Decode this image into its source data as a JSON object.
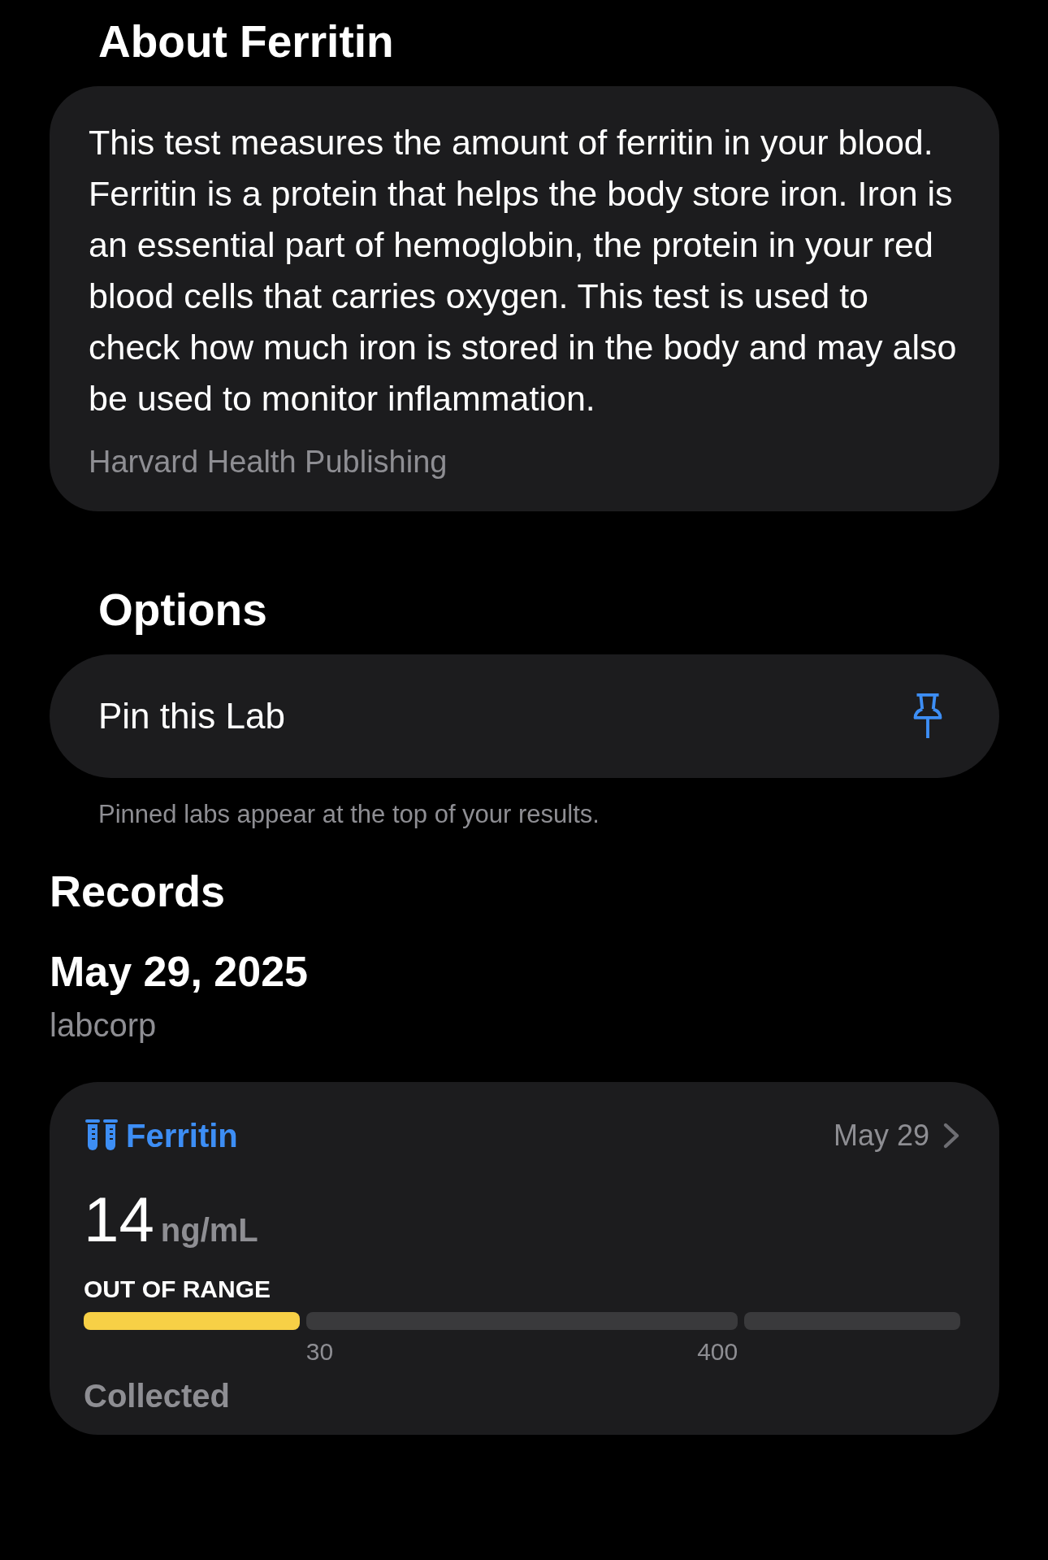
{
  "about": {
    "title": "About Ferritin",
    "description": "This test measures the amount of ferritin in your blood. Ferritin is a protein that helps the body store iron. Iron is an essential part of hemoglobin, the protein in your red blood cells that carries oxygen. This test is used to check how much iron is stored in the body and may also be used to monitor inflammation.",
    "source": "Harvard Health Publishing"
  },
  "options": {
    "title": "Options",
    "items": [
      {
        "label": "Pin this Lab"
      }
    ],
    "footnote": "Pinned labs appear at the top of your results."
  },
  "records": {
    "title": "Records",
    "groups": [
      {
        "date": "May 29, 2025",
        "provider": "labcorp",
        "results": [
          {
            "name": "Ferritin",
            "date": "May 29",
            "value": "14",
            "unit": "ng/mL",
            "status": "OUT OF RANGE",
            "segments": [
              {
                "highlighted": true
              },
              {
                "highlighted": false,
                "start_label": "30",
                "end_label": "400"
              },
              {
                "highlighted": false
              }
            ],
            "footer": "Collected"
          }
        ]
      }
    ]
  }
}
